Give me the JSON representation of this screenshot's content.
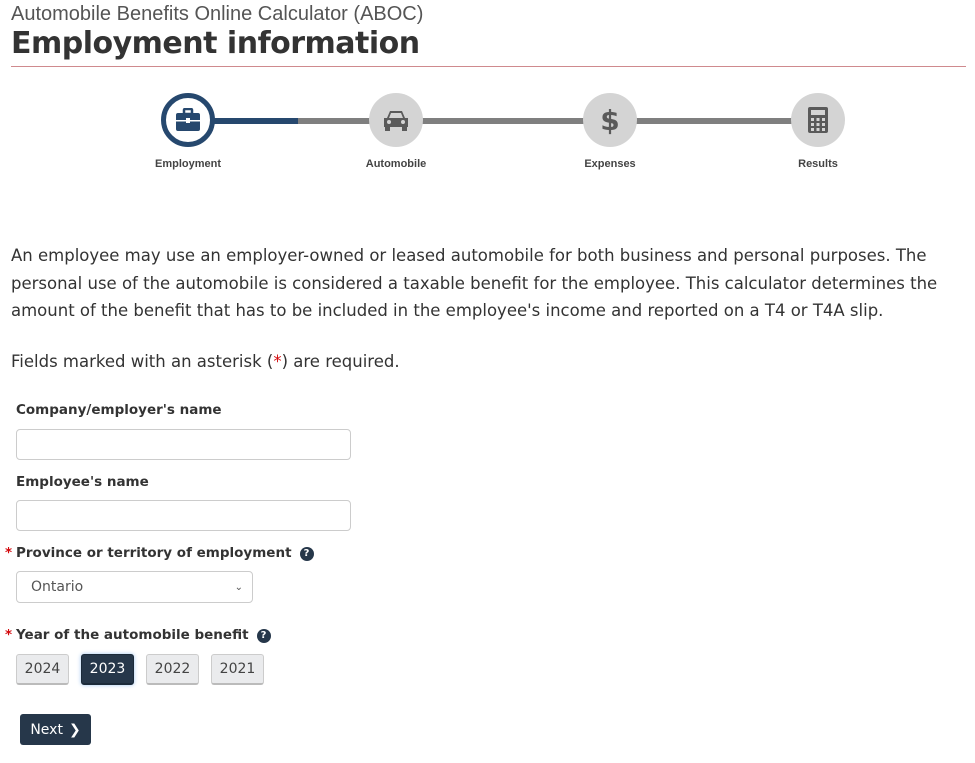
{
  "app_title": "Automobile Benefits Online Calculator (ABOC)",
  "page_title": "Employment information",
  "stepper": {
    "steps": [
      {
        "label": "Employment",
        "icon": "briefcase-icon",
        "active": true
      },
      {
        "label": "Automobile",
        "icon": "car-icon",
        "active": false
      },
      {
        "label": "Expenses",
        "icon": "dollar-icon",
        "active": false
      },
      {
        "label": "Results",
        "icon": "calculator-icon",
        "active": false
      }
    ],
    "active_color": "#26486e",
    "inactive_color": "#d4d4d4"
  },
  "intro": "An employee may use an employer-owned or leased automobile for both business and personal purposes. The personal use of the automobile is considered a taxable benefit for the employee. This calculator determines the amount of the benefit that has to be included in the employee's income and reported on a T4 or T4A slip.",
  "required_note": {
    "before": "Fields marked with an asterisk (",
    "star": "*",
    "after": ") are required."
  },
  "form": {
    "company_label": "Company/employer's name",
    "company_value": "",
    "employee_label": "Employee's name",
    "employee_value": "",
    "province_label": "Province or territory of employment",
    "province_value": "Ontario",
    "year_label": "Year of the automobile benefit",
    "years": [
      "2024",
      "2023",
      "2022",
      "2021"
    ],
    "selected_year": "2023",
    "next_label": "Next"
  }
}
